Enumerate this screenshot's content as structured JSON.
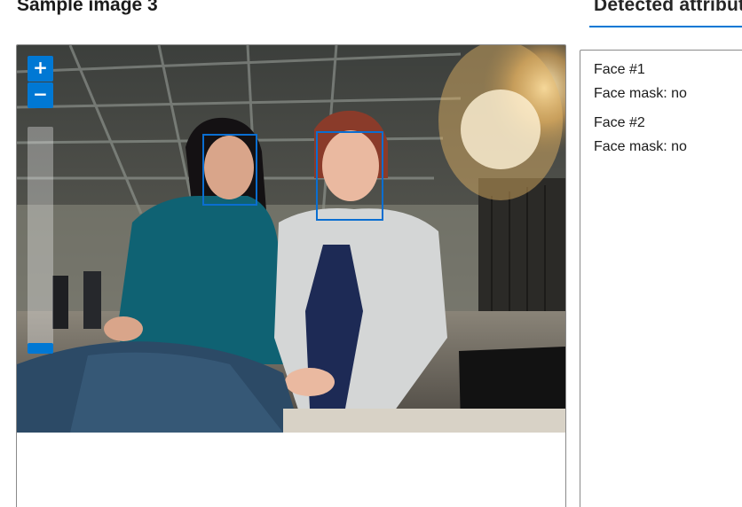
{
  "header": {
    "sample_title": "Sample image 3",
    "tab_label": "Detected attributes"
  },
  "zoom": {
    "in_label": "+",
    "out_label": "−",
    "level": 0.0
  },
  "results": {
    "faces": [
      {
        "title": "Face #1",
        "mask": "Face mask: no"
      },
      {
        "title": "Face #2",
        "mask": "Face mask: no"
      }
    ]
  },
  "colors": {
    "accent": "#0078d4",
    "face_box": "#0a6ed1"
  }
}
